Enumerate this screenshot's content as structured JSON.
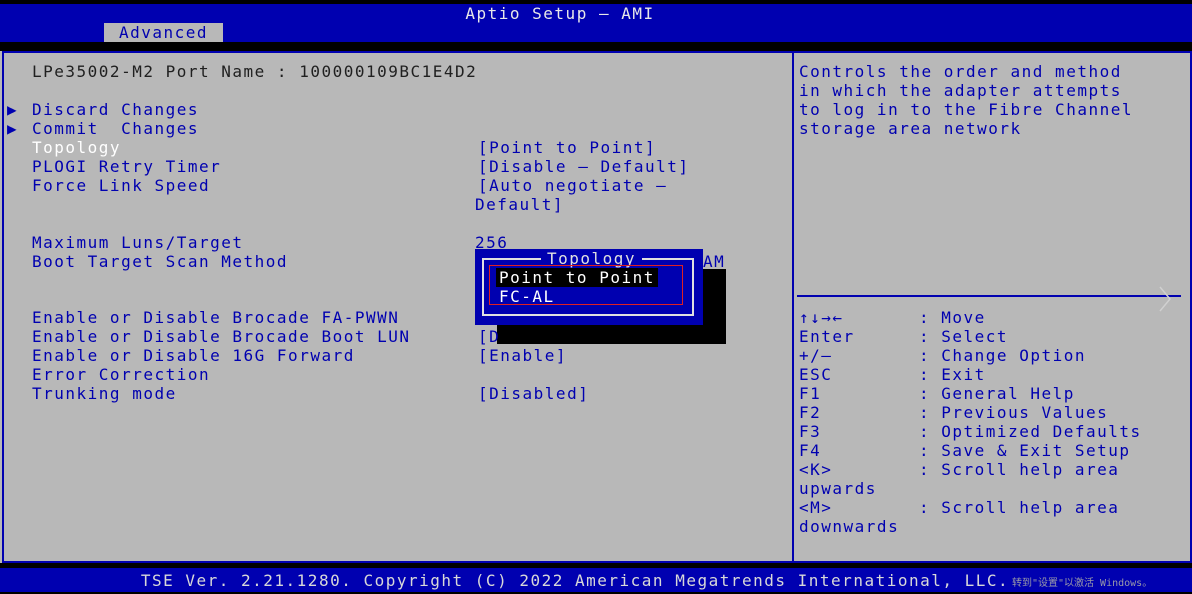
{
  "header": {
    "title": "Aptio Setup – AMI",
    "tab": "Advanced"
  },
  "main": {
    "port_name": "LPe35002-M2 Port Name : 100000109BC1E4D2",
    "actions": [
      {
        "label": "Discard Changes"
      },
      {
        "label": "Commit  Changes"
      }
    ],
    "settings": [
      {
        "label": "Topology",
        "value": "[Point to Point]"
      },
      {
        "label": "PLOGI Retry Timer",
        "value": "[Disable – Default]"
      },
      {
        "label": "Force Link Speed",
        "value": "[Auto negotiate –",
        "value2": "Default]"
      },
      {
        "label": "Maximum Luns/Target",
        "value": "256"
      },
      {
        "label": "Boot Target Scan Method",
        "value": "AM"
      },
      {
        "label": "Enable or Disable Brocade FA-PWWN",
        "value": ""
      },
      {
        "label": "Enable or Disable Brocade Boot LUN",
        "value": "[D"
      },
      {
        "label": "Enable or Disable 16G Forward",
        "value": "[Enable]"
      },
      {
        "label": "Error Correction",
        "value": ""
      },
      {
        "label": "Trunking mode",
        "value": "[Disabled]"
      }
    ]
  },
  "popup": {
    "title": "Topology",
    "options": [
      "Point to Point",
      "FC-AL"
    ],
    "selected": "Point to Point"
  },
  "help": {
    "lines": [
      "Controls the order and method",
      "in which the adapter attempts",
      "to log in to the Fibre Channel",
      "storage area network"
    ]
  },
  "keys": [
    {
      "key": "↑↓→←",
      "desc": ": Move"
    },
    {
      "key": "Enter",
      "desc": ": Select"
    },
    {
      "key": "+/–",
      "desc": ": Change Option"
    },
    {
      "key": "ESC",
      "desc": ": Exit"
    },
    {
      "key": "F1",
      "desc": ": General Help"
    },
    {
      "key": "F2",
      "desc": ": Previous Values"
    },
    {
      "key": "F3",
      "desc": ": Optimized Defaults"
    },
    {
      "key": "F4",
      "desc": ": Save & Exit Setup"
    },
    {
      "key": "<K>",
      "desc": ": Scroll help area",
      "cont": "upwards"
    },
    {
      "key": "<M>",
      "desc": ": Scroll help area",
      "cont": "downwards"
    }
  ],
  "footer": {
    "text": "TSE Ver. 2.21.1280. Copyright (C) 2022 American Megatrends International, LLC.",
    "watermark": "转到\"设置\"以激活 Windows。"
  },
  "colors": {
    "frame": "#0000b0",
    "panel": "#b8b8b8",
    "highlight": "#ffffff",
    "popup_select": "#e02020"
  }
}
